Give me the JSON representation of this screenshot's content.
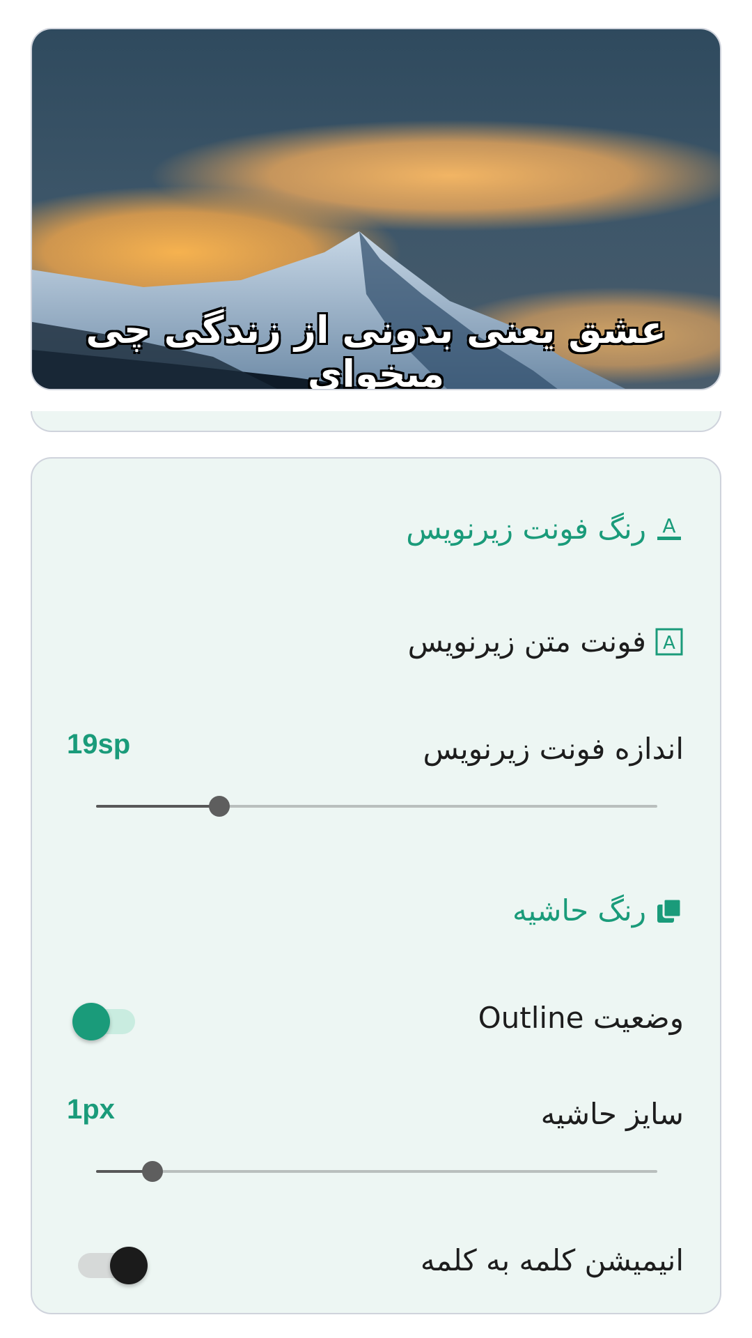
{
  "preview": {
    "subtitle_text": "عشق یعنی بدونی از زندگی چی میخوای"
  },
  "settings": {
    "font_color": {
      "label": "رنگ فونت زیرنویس",
      "icon": "text-color-icon"
    },
    "font_family": {
      "label": "فونت متن زیرنویس",
      "icon": "font-box-icon"
    },
    "font_size": {
      "label": "اندازه فونت زیرنویس",
      "value": "19sp",
      "level": 0.22
    },
    "border_color": {
      "label": "رنگ حاشیه",
      "icon": "copy-layers-icon"
    },
    "outline": {
      "label": "وضعیت Outline",
      "enabled": true
    },
    "border_size": {
      "label": "سایز حاشیه",
      "value": "1px",
      "level": 0.1
    },
    "word_animation": {
      "label": "انیمیشن کلمه به کلمه",
      "enabled": false
    }
  },
  "colors": {
    "accent": "#1a9b7a",
    "card_background": "#edf6f3",
    "text": "#1d1d1d"
  }
}
